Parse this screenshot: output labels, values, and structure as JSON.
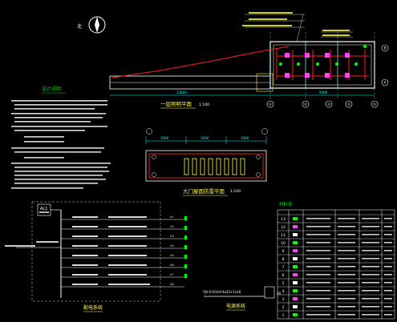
{
  "drawing": {
    "plan_title": "一层照明平面",
    "plan_scale": "1:100",
    "gate_title": "大门屋面防雷平面",
    "gate_scale": "1:100",
    "design_notes_title": "设计说明",
    "legend_title": "材料表",
    "panel_title": "配电系统",
    "power_title": "电源系统",
    "panel_id": "AL1",
    "power_cable": "YJV-0.6/1kV-4x25+1x16",
    "power_box_label": "2A",
    "axis_numbers": [
      "①",
      "②",
      "③",
      "④",
      "⑤"
    ],
    "grid_letters": [
      "A",
      "B"
    ],
    "gate_dims": [
      "3000",
      "3000",
      "3000"
    ],
    "legend_rows": [
      "1",
      "2",
      "3",
      "4",
      "5",
      "6",
      "7",
      "8",
      "9",
      "10",
      "11",
      "12",
      "13"
    ],
    "panel_circuits": [
      "n1",
      "n2",
      "n3",
      "n4",
      "n5",
      "n6",
      "n7",
      "n8"
    ],
    "colors": {
      "background": "#000000",
      "lines": "#ffffff",
      "wiring": "#ff2020",
      "text_green": "#00e000",
      "text_yellow": "#ffff40",
      "dims": "#00ffff",
      "accent_magenta": "#ff40ff"
    }
  }
}
